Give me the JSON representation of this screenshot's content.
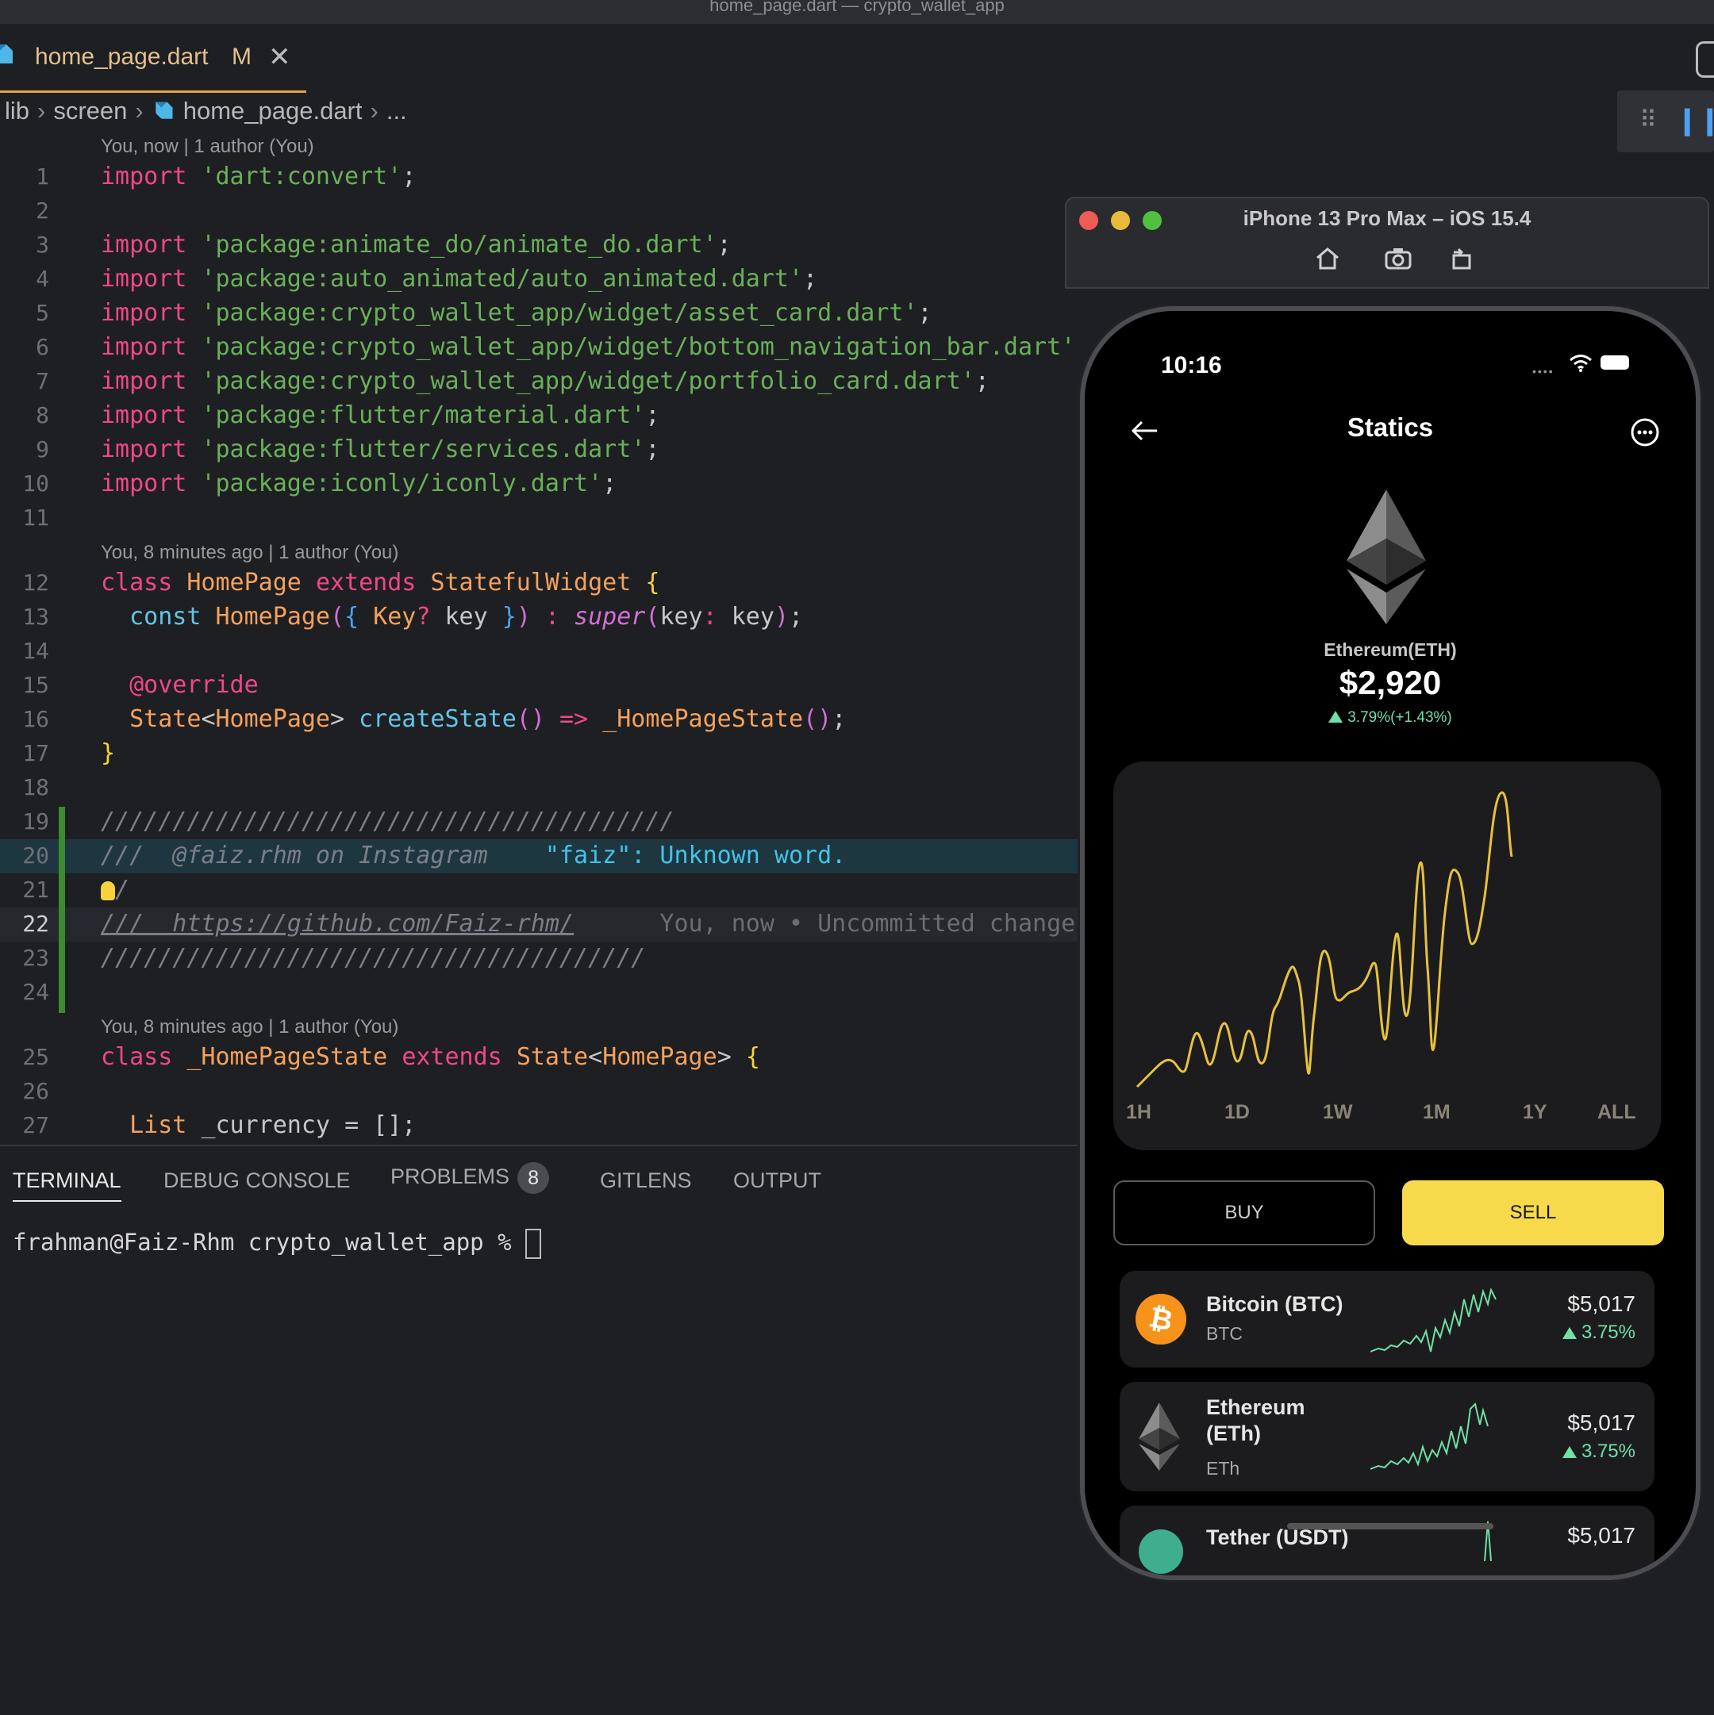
{
  "window": {
    "title": "home_page.dart — crypto_wallet_app"
  },
  "tab": {
    "name": "home_page.dart",
    "status": "M",
    "close": "✕"
  },
  "breadcrumb": {
    "items": [
      "lib",
      "screen",
      "home_page.dart",
      "..."
    ]
  },
  "lens": {
    "a": "You, now | 1 author (You)",
    "b": "You, 8 minutes ago | 1 author (You)",
    "c": "You, 8 minutes ago | 1 author (You)"
  },
  "line_numbers": [
    "1",
    "2",
    "3",
    "4",
    "5",
    "6",
    "7",
    "8",
    "9",
    "10",
    "11",
    "12",
    "13",
    "14",
    "15",
    "16",
    "17",
    "18",
    "19",
    "20",
    "21",
    "22",
    "23",
    "24",
    "25",
    "26",
    "27"
  ],
  "code": {
    "import": "import",
    "semi": ";",
    "l1": "'dart:convert'",
    "l3": "'package:animate_do/animate_do.dart'",
    "l4": "'package:auto_animated/auto_animated.dart'",
    "l5": "'package:crypto_wallet_app/widget/asset_card.dart'",
    "l6": "'package:crypto_wallet_app/widget/bottom_navigation_bar.dart'",
    "l7": "'package:crypto_wallet_app/widget/portfolio_card.dart'",
    "l8": "'package:flutter/material.dart'",
    "l9": "'package:flutter/services.dart'",
    "l10": "'package:iconly/iconly.dart'",
    "class": "class",
    "extends": "extends",
    "homepage": "HomePage",
    "stateful": "StatefulWidget",
    "const": "const",
    "key_type": "Key",
    "key": "key",
    "super": "super",
    "override": "@override",
    "state": "State",
    "create_state": "createState",
    "arrow": "=>",
    "homepage_state_call": "_HomePageState",
    "homepage_state": "_HomePageState",
    "l19": "////////////////////////////////////////",
    "l20": "///  @faiz.rhm on Instagram",
    "l20_diag": "\"faiz\": Unknown word.",
    "l21": "/",
    "l22": "///  https://github.com/Faiz-rhm/",
    "l22_ghost": "You, now • Uncommitted changes",
    "l23": "//////////////////////////////////////",
    "list": "List",
    "currency": "_currency",
    "l27_rest": "= [];"
  },
  "panel": {
    "tabs": [
      "TERMINAL",
      "DEBUG CONSOLE",
      "PROBLEMS",
      "GITLENS",
      "OUTPUT"
    ],
    "problems_count": "8",
    "prompt": "frahman@Faiz-Rhm crypto_wallet_app % "
  },
  "simulator": {
    "title": "iPhone 13 Pro Max – iOS 15.4"
  },
  "phone": {
    "time": "10:16",
    "screen_title": "Statics",
    "coin_name": "Ethereum(ETH)",
    "coin_price": "$2,920",
    "coin_change": "3.79%(+1.43%)",
    "periods": [
      "1H",
      "1D",
      "1W",
      "1M",
      "1Y",
      "ALL"
    ],
    "buy": "BUY",
    "sell": "SELL",
    "assets": [
      {
        "name": "Bitcoin (BTC)",
        "symbol": "BTC",
        "price": "$5,017",
        "change": "3.75%"
      },
      {
        "name": "Ethereum (ETh)",
        "symbol": "ETh",
        "price": "$5,017",
        "change": "3.75%"
      },
      {
        "name": "Tether (USDT)",
        "symbol": "",
        "price": "$5,017",
        "change": ""
      }
    ]
  },
  "colors": {
    "accent": "#f7d94c",
    "positive": "#6fe0a8",
    "tab_underline": "#e6a33e",
    "git_added": "#3a8a2f"
  },
  "icons": {
    "tab": "dart-file-icon",
    "back": "arrow-left-icon",
    "more": "more-circle-icon",
    "coin": "ethereum-logo-icon",
    "simulator": [
      "home-icon",
      "screenshot-icon",
      "rotate-icon"
    ]
  }
}
